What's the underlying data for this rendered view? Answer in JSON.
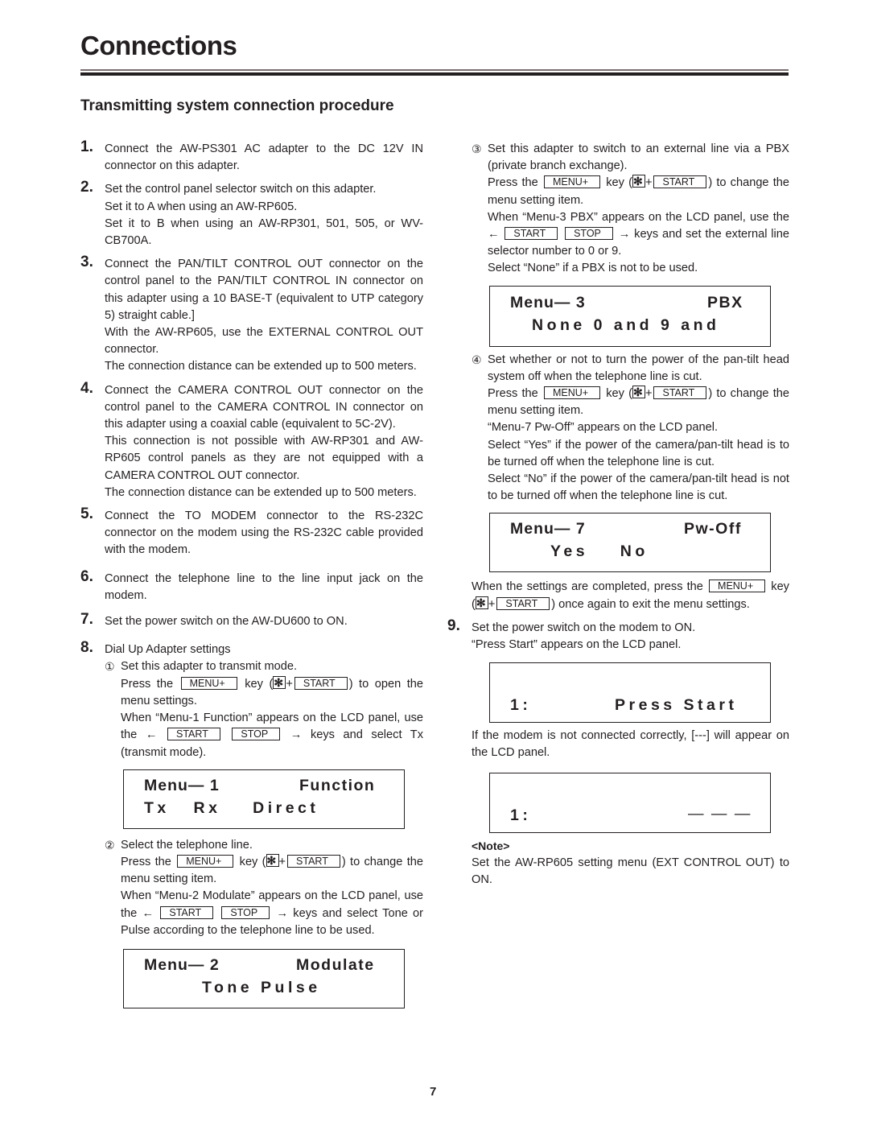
{
  "page": {
    "title": "Connections",
    "section_title": "Transmitting system connection procedure",
    "page_number": "7"
  },
  "keys": {
    "menu_plus": "MENU+",
    "start": "START",
    "stop": "STOP",
    "star": "✻",
    "plus": "+",
    "left_arrow": "←",
    "right_arrow": "→"
  },
  "steps": [
    {
      "num": "1.",
      "paragraphs": [
        "Connect the AW-PS301 AC adapter to the DC 12V IN connector on this adapter."
      ]
    },
    {
      "num": "2.",
      "paragraphs": [
        "Set the control panel selector switch on this adapter.",
        "Set it to A when using an AW-RP605.",
        "Set it to B when using an AW-RP301, 501, 505, or WV-CB700A."
      ]
    },
    {
      "num": "3.",
      "paragraphs": [
        "Connect the PAN/TILT CONTROL OUT connector on the control panel to the PAN/TILT CONTROL IN connector on this adapter using a 10 BASE-T (equivalent to UTP category 5) straight cable.]",
        "With the AW-RP605, use the EXTERNAL CONTROL OUT connector.",
        "The connection distance can be extended up to 500 meters."
      ]
    },
    {
      "num": "4.",
      "paragraphs": [
        "Connect the CAMERA CONTROL OUT connector on the control panel to the CAMERA CONTROL IN connector on this adapter using a coaxial cable (equivalent to 5C-2V).",
        "This connection is not possible with AW-RP301 and AW-RP605 control panels as they are not equipped with a CAMERA CONTROL OUT connector.",
        "The connection distance can be extended up to 500 meters."
      ]
    },
    {
      "num": "5.",
      "paragraphs": [
        "Connect the TO MODEM connector to the RS-232C connector on the modem using the RS-232C cable provided with the modem."
      ]
    },
    {
      "num": "6.",
      "paragraphs": [
        "Connect the telephone line to the line input jack on the modem."
      ]
    },
    {
      "num": "7.",
      "paragraphs": [
        "Set the power switch on the AW-DU600 to ON."
      ]
    },
    {
      "num": "8.",
      "paragraphs": [
        "Dial Up Adapter settings"
      ]
    },
    {
      "num": "9.",
      "paragraphs": [
        "Set the power switch on the modem to ON.",
        "“Press Start” appears on the LCD panel."
      ]
    }
  ],
  "substeps": [
    {
      "mark": "①",
      "intro": "Set this adapter to transmit mode.",
      "press_pre": "Press the",
      "press_mid": "key (",
      "press_post": ") to open the menu settings.",
      "when_text": "When “Menu-1 Function” appears on the LCD panel, use the",
      "keys_post": "keys and select Tx (transmit mode).",
      "lcd": {
        "line1_left": "Menu— 1",
        "line1_right": "Function",
        "line2": "Tx   Rx    Direct"
      }
    },
    {
      "mark": "②",
      "intro": "Select the telephone line.",
      "press_pre": "Press the",
      "press_mid": "key (",
      "press_post": ") to change the menu setting item.",
      "when_text": "When “Menu-2 Modulate” appears on the LCD panel, use the",
      "keys_post": "keys and select Tone or Pulse according to the telephone line to be used.",
      "lcd": {
        "line1_left": "Menu— 2",
        "line1_right": "Modulate",
        "line2": "Tone Pulse"
      }
    },
    {
      "mark": "③",
      "intro": "Set this adapter to switch to an external line via a PBX (private branch exchange).",
      "press_pre": "Press the",
      "press_mid": "key (",
      "press_post": ") to change the menu setting item.",
      "when_text": "When “Menu-3 PBX” appears on the LCD panel, use the",
      "keys_post": "keys and set the external line selector number to 0 or 9.",
      "extra": "Select “None” if a PBX is not to be used.",
      "lcd": {
        "line1_left": "Menu— 3",
        "line1_right": "PBX",
        "line2": "None 0 and 9 and"
      }
    },
    {
      "mark": "④",
      "intro": "Set whether or not to turn the power of the pan-tilt head system off when the telephone line is cut.",
      "press_pre": "Press the",
      "press_mid": "key (",
      "press_post": ") to change the menu setting item.",
      "extra1": "“Menu-7 Pw-Off” appears on the LCD panel.",
      "extra2": "Select “Yes” if the power of the camera/pan-tilt head is to be turned off when the telephone line is cut.",
      "extra3": "Select “No” if the power of the camera/pan-tilt head is not to be turned off when the telephone line is cut.",
      "lcd": {
        "line1_left": "Menu— 7",
        "line1_right": "Pw-Off",
        "line2": "Yes    No"
      }
    }
  ],
  "completion": {
    "pre": "When the settings are completed, press the",
    "mid": "key (",
    "post": ") once again to exit the menu settings."
  },
  "lcd_press_start": {
    "left": "1:",
    "right": "Press Start"
  },
  "modem_error_text": "If the modem is not connected correctly, [---] will appear on the LCD panel.",
  "lcd_error": {
    "left": "1:",
    "right": "— — —"
  },
  "note": {
    "label": "<Note>",
    "text": "Set the AW-RP605 setting menu (EXT CONTROL OUT) to ON."
  }
}
